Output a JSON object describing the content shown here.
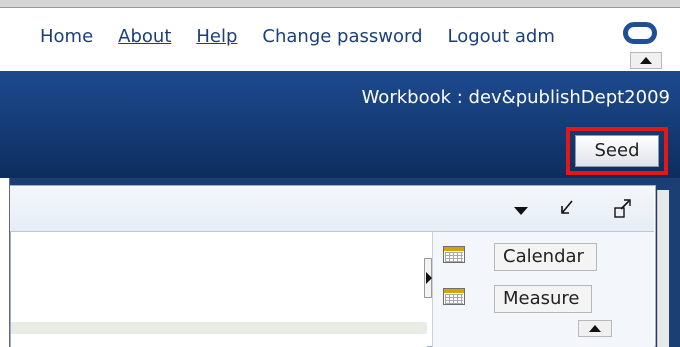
{
  "header": {
    "nav": [
      {
        "label": "Home",
        "name": "home-link"
      },
      {
        "label": "About",
        "name": "about-link"
      },
      {
        "label": "Help",
        "name": "help-link"
      },
      {
        "label": "Change password",
        "name": "change-password-link"
      },
      {
        "label": "Logout adm",
        "name": "logout-link"
      }
    ],
    "logo_icon": "oracle-logo-icon"
  },
  "workbook": {
    "label": "Workbook : dev&publishDept2009"
  },
  "toolbar": {
    "seed_label": "Seed"
  },
  "panel": {
    "header_icons": [
      "dropdown-arrow-icon",
      "restore-down-icon",
      "maximize-icon"
    ],
    "side_items": [
      {
        "label": "Calendar",
        "icon": "grid-icon"
      },
      {
        "label": "Measure",
        "icon": "grid-icon"
      }
    ]
  },
  "colors": {
    "brand_blue": "#173f7c",
    "highlight": "#e01818",
    "link": "#1c3f7a"
  }
}
